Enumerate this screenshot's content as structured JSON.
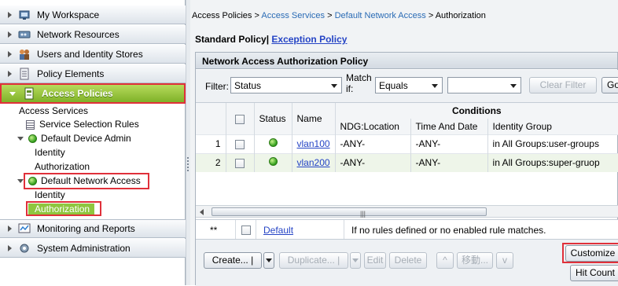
{
  "nav": {
    "drawers": [
      {
        "label": "My Workspace",
        "icon": "workspace-icon"
      },
      {
        "label": "Network Resources",
        "icon": "network-icon"
      },
      {
        "label": "Users and Identity Stores",
        "icon": "users-icon"
      },
      {
        "label": "Policy Elements",
        "icon": "policy-elements-icon"
      },
      {
        "label": "Access Policies",
        "icon": "access-policies-icon"
      },
      {
        "label": "Monitoring and Reports",
        "icon": "monitoring-icon"
      },
      {
        "label": "System Administration",
        "icon": "system-admin-icon"
      }
    ],
    "tree": {
      "access_services": "Access Services",
      "service_selection_rules": "Service Selection Rules",
      "default_device_admin": "Default Device Admin",
      "identity_1": "Identity",
      "authorization_1": "Authorization",
      "default_network_access": "Default Network Access",
      "identity_2": "Identity",
      "authorization_2": "Authorization"
    },
    "accent_color": "#8ec63f",
    "highlight_color": "#e0303a"
  },
  "breadcrumb": {
    "part1": "Access Policies",
    "sep": " > ",
    "part2": "Access Services",
    "part3": "Default Network Access",
    "part4": "Authorization"
  },
  "policy_tabs": {
    "standard": "Standard Policy",
    "separator": "|",
    "exception": "Exception Policy"
  },
  "panel": {
    "title": "Network Access Authorization Policy",
    "filter": {
      "label": "Filter:",
      "field_value": "Status",
      "match_if_label_1": "Match",
      "match_if_label_2": "if:",
      "operator_value": "Equals",
      "value": "",
      "clear_button": "Clear Filter",
      "go_button": "Go"
    },
    "table": {
      "headers": {
        "status": "Status",
        "name": "Name",
        "conditions": "Conditions",
        "ndg_location": "NDG:Location",
        "time_and_date": "Time And Date",
        "identity_group": "Identity Group"
      },
      "rows": [
        {
          "num": "1",
          "name": "vlan100",
          "ndg": "-ANY-",
          "time": "-ANY-",
          "group": "in All Groups:user-groups"
        },
        {
          "num": "2",
          "name": "vlan200",
          "ndg": "-ANY-",
          "time": "-ANY-",
          "group": "in All Groups:super-gruop"
        }
      ]
    },
    "default_row": {
      "marker": "**",
      "name": "Default",
      "text": "If no rules defined or no enabled rule matches."
    },
    "buttons": {
      "create": "Create... |",
      "duplicate": "Duplicate... |",
      "edit": "Edit",
      "delete": "Delete",
      "up": "^",
      "move": "移動...",
      "down": "v",
      "customize": "Customize",
      "hit_count": "Hit Count"
    }
  }
}
